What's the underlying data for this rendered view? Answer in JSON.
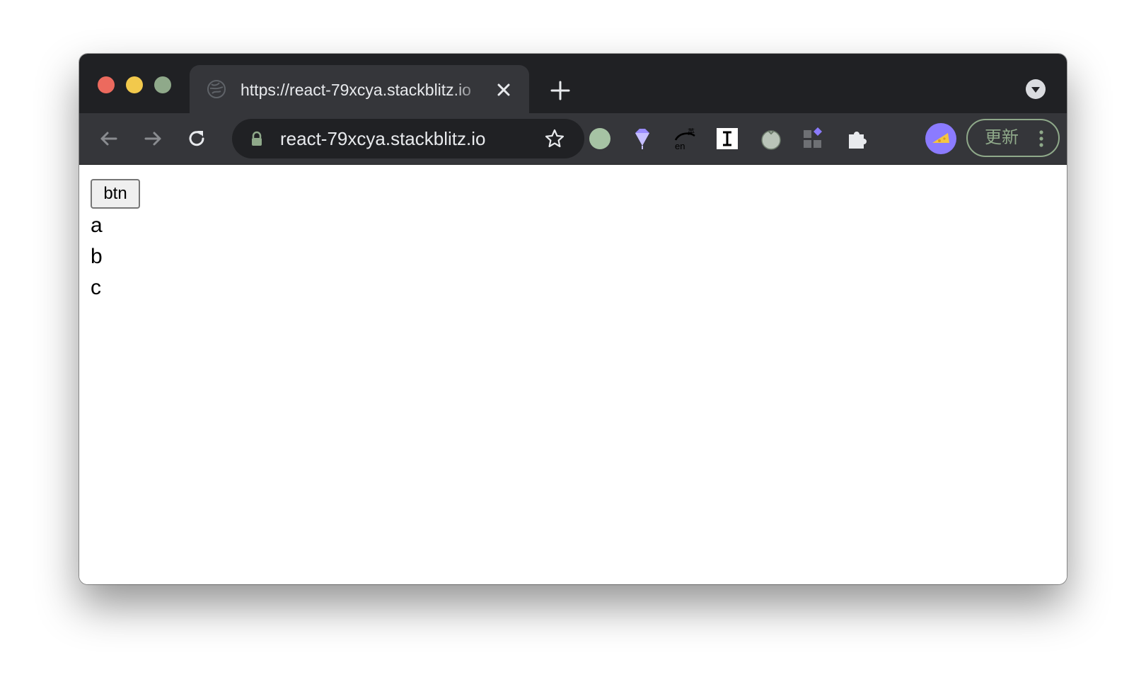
{
  "browser": {
    "tab": {
      "title": "https://react-79xcya.stackblitz.io"
    },
    "omnibox": {
      "url": "react-79xcya.stackblitz.io"
    },
    "update_button": {
      "label": "更新"
    },
    "icons": [
      "close-window-icon",
      "minimize-window-icon",
      "maximize-window-icon",
      "globe-icon",
      "close-tab-icon",
      "plus-icon",
      "tab-search-icon",
      "back-arrow-icon",
      "forward-arrow-icon",
      "reload-icon",
      "lock-icon",
      "star-icon",
      "circle-extension-icon",
      "diamond-extension-icon",
      "translate-extension-icon",
      "instapaper-extension-icon",
      "tomato-extension-icon",
      "apps-extension-icon",
      "puzzle-extension-icon",
      "profile-avatar-icon",
      "more-vertical-icon"
    ],
    "colors": {
      "titlebar": "#202124",
      "toolbar": "#35363a",
      "accent_update": "#8fa98a",
      "avatar": "#8b7bff"
    }
  },
  "page": {
    "button_label": "btn",
    "list_items": [
      "a",
      "b",
      "c"
    ]
  }
}
